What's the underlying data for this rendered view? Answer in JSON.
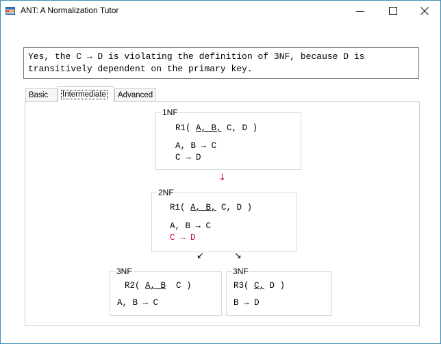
{
  "window": {
    "title": "ANT: A Normalization Tutor",
    "app_icon": "database-table-icon",
    "controls": [
      "minimize-icon",
      "maximize-icon",
      "close-icon"
    ]
  },
  "message": "Yes, the C → D is violating the definition of 3NF, because D is\ntransitively dependent on the primary key.",
  "tabs": [
    {
      "label": "Basic"
    },
    {
      "label": "Intermediate",
      "selected": true
    },
    {
      "label": "Advanced"
    }
  ],
  "colors": {
    "violation": "#cc1133",
    "window_border": "#3c8fb3"
  },
  "diagram": {
    "nf1": {
      "label": "1NF",
      "relation": {
        "prefix": "R1( ",
        "key": "A, B,",
        "rest": " C, D )"
      },
      "fds": [
        "A, B → C",
        "C → D"
      ]
    },
    "arrow_down": "↓",
    "nf2": {
      "label": "2NF",
      "relation": {
        "prefix": "R1( ",
        "key": "A, B,",
        "rest": " C, D )"
      },
      "fds": [
        "A, B → C"
      ],
      "violating_fd": "C → D"
    },
    "arrow_left": "↙",
    "arrow_right": "↘",
    "nf3_left": {
      "label": "3NF",
      "relation": {
        "prefix": "R2( ",
        "key": "A, B",
        "rest": "  C )"
      },
      "fds": [
        "A, B → C"
      ]
    },
    "nf3_right": {
      "label": "3NF",
      "relation": {
        "prefix": "R3( ",
        "key": "C,",
        "rest": " D )"
      },
      "fds": [
        "B → D"
      ]
    }
  }
}
